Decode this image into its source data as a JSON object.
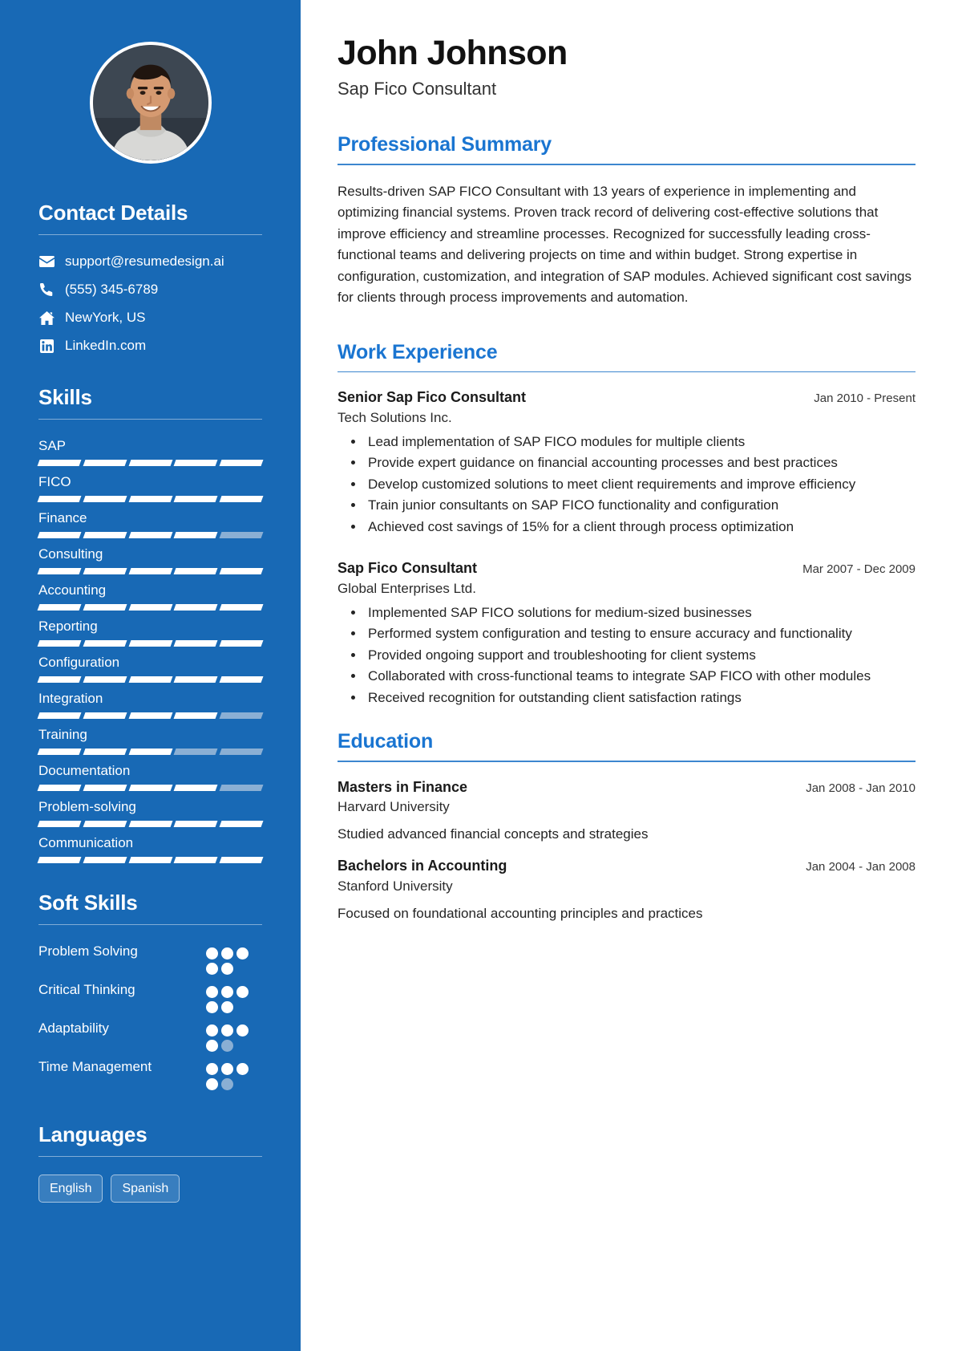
{
  "theme": {
    "sidebar_bg": "#1869b5",
    "accent": "#1a75d1",
    "bar_filled": "#ffffff",
    "bar_empty": "#8aafd4"
  },
  "header": {
    "name": "John Johnson",
    "job_title": "Sap Fico Consultant"
  },
  "sidebar": {
    "contact": {
      "heading": "Contact Details",
      "items": [
        {
          "icon": "email-icon",
          "value": "support@resumedesign.ai"
        },
        {
          "icon": "phone-icon",
          "value": "(555) 345-6789"
        },
        {
          "icon": "home-icon",
          "value": "NewYork, US"
        },
        {
          "icon": "linkedin-icon",
          "value": "LinkedIn.com"
        }
      ]
    },
    "skills": {
      "heading": "Skills",
      "max_level": 5,
      "items": [
        {
          "name": "SAP",
          "level": 5
        },
        {
          "name": "FICO",
          "level": 5
        },
        {
          "name": "Finance",
          "level": 4
        },
        {
          "name": "Consulting",
          "level": 5
        },
        {
          "name": "Accounting",
          "level": 5
        },
        {
          "name": "Reporting",
          "level": 5
        },
        {
          "name": "Configuration",
          "level": 5
        },
        {
          "name": "Integration",
          "level": 4
        },
        {
          "name": "Training",
          "level": 3
        },
        {
          "name": "Documentation",
          "level": 4
        },
        {
          "name": "Problem-solving",
          "level": 5
        },
        {
          "name": "Communication",
          "level": 5
        }
      ]
    },
    "soft_skills": {
      "heading": "Soft Skills",
      "max_level": 5,
      "items": [
        {
          "name": "Problem Solving",
          "level": 5
        },
        {
          "name": "Critical Thinking",
          "level": 5
        },
        {
          "name": "Adaptability",
          "level": 4
        },
        {
          "name": "Time Management",
          "level": 4
        }
      ]
    },
    "languages": {
      "heading": "Languages",
      "items": [
        "English",
        "Spanish"
      ]
    }
  },
  "main": {
    "summary": {
      "title": "Professional Summary",
      "text": "Results-driven SAP FICO Consultant with 13 years of experience in implementing and optimizing financial systems. Proven track record of delivering cost-effective solutions that improve efficiency and streamline processes. Recognized for successfully leading cross-functional teams and delivering projects on time and within budget. Strong expertise in configuration, customization, and integration of SAP modules. Achieved significant cost savings for clients through process improvements and automation."
    },
    "work": {
      "title": "Work Experience",
      "items": [
        {
          "role": "Senior Sap Fico Consultant",
          "company": "Tech Solutions Inc.",
          "date": "Jan 2010 - Present",
          "bullets": [
            "Lead implementation of SAP FICO modules for multiple clients",
            "Provide expert guidance on financial accounting processes and best practices",
            "Develop customized solutions to meet client requirements and improve efficiency",
            "Train junior consultants on SAP FICO functionality and configuration",
            "Achieved cost savings of 15% for a client through process optimization"
          ]
        },
        {
          "role": "Sap Fico Consultant",
          "company": "Global Enterprises Ltd.",
          "date": "Mar 2007 - Dec 2009",
          "bullets": [
            "Implemented SAP FICO solutions for medium-sized businesses",
            "Performed system configuration and testing to ensure accuracy and functionality",
            "Provided ongoing support and troubleshooting for client systems",
            "Collaborated with cross-functional teams to integrate SAP FICO with other modules",
            "Received recognition for outstanding client satisfaction ratings"
          ]
        }
      ]
    },
    "education": {
      "title": "Education",
      "items": [
        {
          "degree": "Masters in Finance",
          "school": "Harvard University",
          "date": "Jan 2008 - Jan 2010",
          "description": "Studied advanced financial concepts and strategies"
        },
        {
          "degree": "Bachelors in Accounting",
          "school": "Stanford University",
          "date": "Jan 2004 - Jan 2008",
          "description": "Focused on foundational accounting principles and practices"
        }
      ]
    }
  }
}
